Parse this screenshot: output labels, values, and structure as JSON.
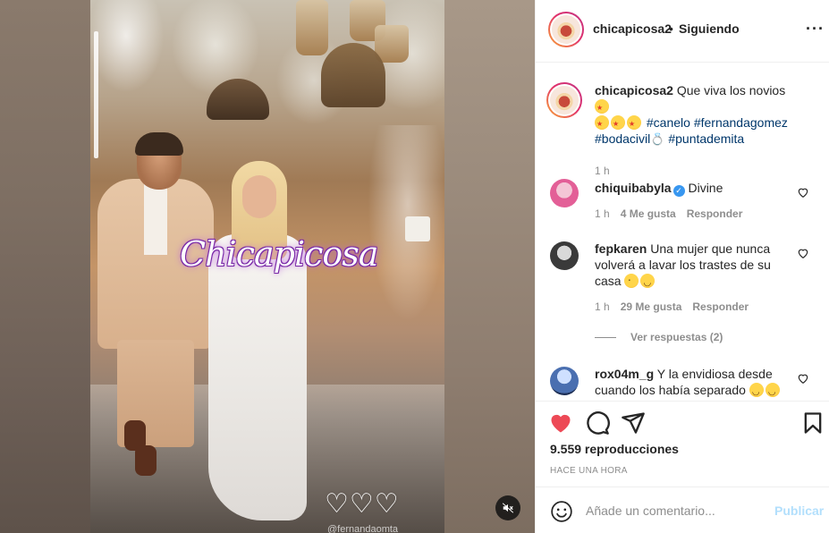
{
  "post": {
    "username": "chicapicosa2",
    "separator": "•",
    "follow_status": "Siguiendo",
    "more_icon": "more-options-icon"
  },
  "media": {
    "watermark": "Chicapicosa",
    "hearts": "♡♡♡",
    "credit": "@fernandaomta",
    "progress": 0.24
  },
  "caption": {
    "username": "chicapicosa2",
    "text_before": "Que viva los novios",
    "hashtags": [
      "#canelo",
      "#fernandagomez",
      "#bodacivil",
      "#puntademita"
    ],
    "time": "1 h"
  },
  "comments": [
    {
      "username": "chiquibabyla",
      "verified": true,
      "text": "Divine",
      "time": "1 h",
      "likes": "4 Me gusta",
      "reply": "Responder"
    },
    {
      "username": "fepkaren",
      "verified": false,
      "text": "Una mujer que nunca volverá a lavar los trastes de su casa",
      "time": "1 h",
      "likes": "29 Me gusta",
      "reply": "Responder",
      "view_replies": "Ver respuestas (2)"
    },
    {
      "username": "rox04m_g",
      "verified": false,
      "text": "Y la envidiosa desde cuando los había separado"
    }
  ],
  "actions": {
    "views": "9.559 reproducciones",
    "posted": "HACE UNA HORA",
    "like_color": "#ed4956"
  },
  "composer": {
    "placeholder": "Añade un comentario...",
    "submit": "Publicar"
  },
  "colors": {
    "link": "#00376b",
    "muted": "#8e8e8e",
    "text": "#262626",
    "publish_disabled": "#b2dffc"
  }
}
